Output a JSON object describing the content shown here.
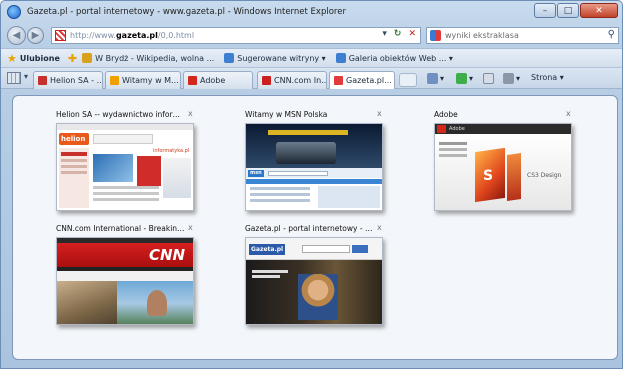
{
  "window": {
    "title": "Gazeta.pl - portal internetowy - www.gazeta.pl - Windows Internet Explorer",
    "caption": {
      "minimize": "–",
      "maximize": "□",
      "close": "✕"
    }
  },
  "address_bar": {
    "prefix": "http://www.",
    "host": "gazeta.pl",
    "suffix": "/0,0.html",
    "search_placeholder": "wyniki ekstraklasa"
  },
  "favorites_bar": {
    "label": "Ulubione",
    "items": [
      {
        "label": "W Brydż - Wikipedia, wolna ...",
        "color": "#d9a11e"
      },
      {
        "label": "Sugerowane witryny ▾",
        "color": "#3d7fd0"
      },
      {
        "label": "Galeria obiektów Web ... ▾",
        "color": "#3d7fd0"
      }
    ]
  },
  "tabs": [
    {
      "label": "Helion SA - ...",
      "color": "#c8302b"
    },
    {
      "label": "Witamy w M...",
      "color": "#f0a000"
    },
    {
      "label": "Adobe",
      "color": "#d3281b"
    },
    {
      "label": "CNN.com In...",
      "color": "#cc1f1f"
    },
    {
      "label": "Gazeta.pl...",
      "color": "#e23b3b"
    }
  ],
  "command_bar": {
    "page_label": "Strona ▾"
  },
  "quick_tabs": [
    {
      "title": "Helion SA -- wydawnictwo inform...",
      "close": "x",
      "site": "helion"
    },
    {
      "title": "Witamy w MSN Polska",
      "close": "x",
      "site": "msn"
    },
    {
      "title": "Adobe",
      "close": "x",
      "site": "adobe"
    },
    {
      "title": "CNN.com International - Breaking...",
      "close": "x",
      "site": "cnn"
    },
    {
      "title": "Gazeta.pl - portal internetowy - w...",
      "close": "x",
      "site": "gazeta"
    }
  ],
  "thumb_text": {
    "helion_logo": "helion",
    "helion_sub": "informatyka.pl",
    "msn_logo": "msn",
    "adobe_logo": "Adobe",
    "adobe_product": "CS3 Design",
    "cnn_logo": "CNN",
    "gazeta_logo": "Gazeta.pl"
  }
}
